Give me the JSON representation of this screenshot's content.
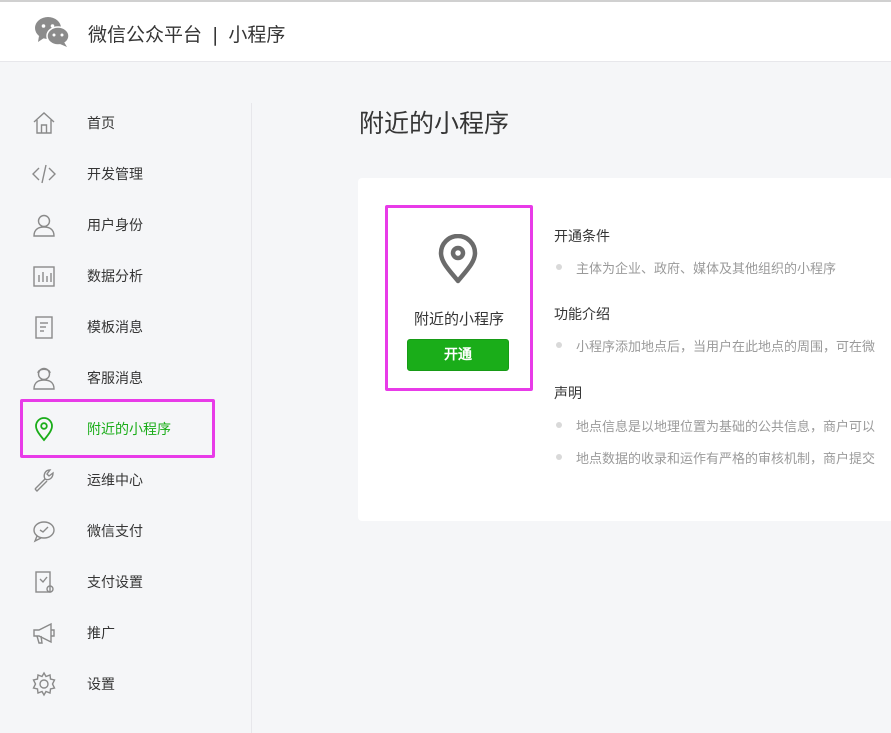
{
  "header": {
    "brand_primary": "微信公众平台",
    "separator": "|",
    "brand_secondary": "小程序",
    "logo_icon": "wechat-logo-icon"
  },
  "sidebar": {
    "items": [
      {
        "label": "首页",
        "icon": "home-icon"
      },
      {
        "label": "开发管理",
        "icon": "code-icon"
      },
      {
        "label": "用户身份",
        "icon": "user-icon"
      },
      {
        "label": "数据分析",
        "icon": "bar-chart-icon"
      },
      {
        "label": "模板消息",
        "icon": "document-icon"
      },
      {
        "label": "客服消息",
        "icon": "customer-service-icon"
      },
      {
        "label": "附近的小程序",
        "icon": "location-pin-icon",
        "active": true
      },
      {
        "label": "运维中心",
        "icon": "wrench-icon"
      },
      {
        "label": "微信支付",
        "icon": "wechat-pay-icon"
      },
      {
        "label": "支付设置",
        "icon": "payment-settings-icon"
      },
      {
        "label": "推广",
        "icon": "megaphone-icon"
      },
      {
        "label": "设置",
        "icon": "gear-icon"
      }
    ]
  },
  "main": {
    "page_title": "附近的小程序",
    "plugin": {
      "name": "附近的小程序",
      "button_label": "开通",
      "icon": "location-pin-icon"
    },
    "sections": [
      {
        "title": "开通条件",
        "bullets": [
          "主体为企业、政府、媒体及其他组织的小程序"
        ]
      },
      {
        "title": "功能介绍",
        "bullets": [
          "小程序添加地点后，当用户在此地点的周围，可在微"
        ]
      },
      {
        "title": "声明",
        "bullets": [
          "地点信息是以地理位置为基础的公共信息，商户可以",
          "地点数据的收录和运作有严格的审核机制，商户提交"
        ]
      }
    ]
  },
  "colors": {
    "accent_green": "#1aad19",
    "highlight_magenta": "#e83be8",
    "background": "#f5f6f8"
  }
}
